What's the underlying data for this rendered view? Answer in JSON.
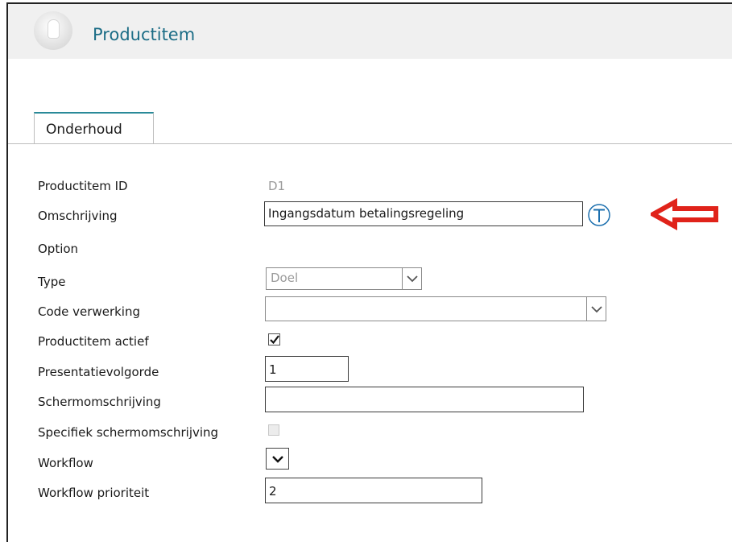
{
  "header": {
    "title": "Productitem"
  },
  "tabs": [
    {
      "label": "Onderhoud"
    }
  ],
  "form": {
    "productitem_id": {
      "label": "Productitem ID",
      "value": "D1"
    },
    "omschrijving": {
      "label": "Omschrijving",
      "value": "Ingangsdatum betalingsregeling",
      "translate_icon": "T"
    },
    "option": {
      "label": "Option"
    },
    "type": {
      "label": "Type",
      "value": "Doel"
    },
    "code_verwerking": {
      "label": "Code verwerking",
      "value": ""
    },
    "productitem_actief": {
      "label": "Productitem actief",
      "checked": true
    },
    "presentatievolgorde": {
      "label": "Presentatievolgorde",
      "value": "1"
    },
    "schermomschrijving": {
      "label": "Schermomschrijving",
      "value": ""
    },
    "specifiek_schermomschrijving": {
      "label": "Specifiek schermomschrijving",
      "checked": false,
      "disabled": true
    },
    "workflow": {
      "label": "Workflow"
    },
    "workflow_prioriteit": {
      "label": "Workflow prioriteit",
      "value": "2"
    }
  },
  "colors": {
    "title": "#1c6d86",
    "tab_accent": "#2a8a99",
    "annotation_arrow": "#e0231a",
    "t_icon": "#1b6fae"
  }
}
